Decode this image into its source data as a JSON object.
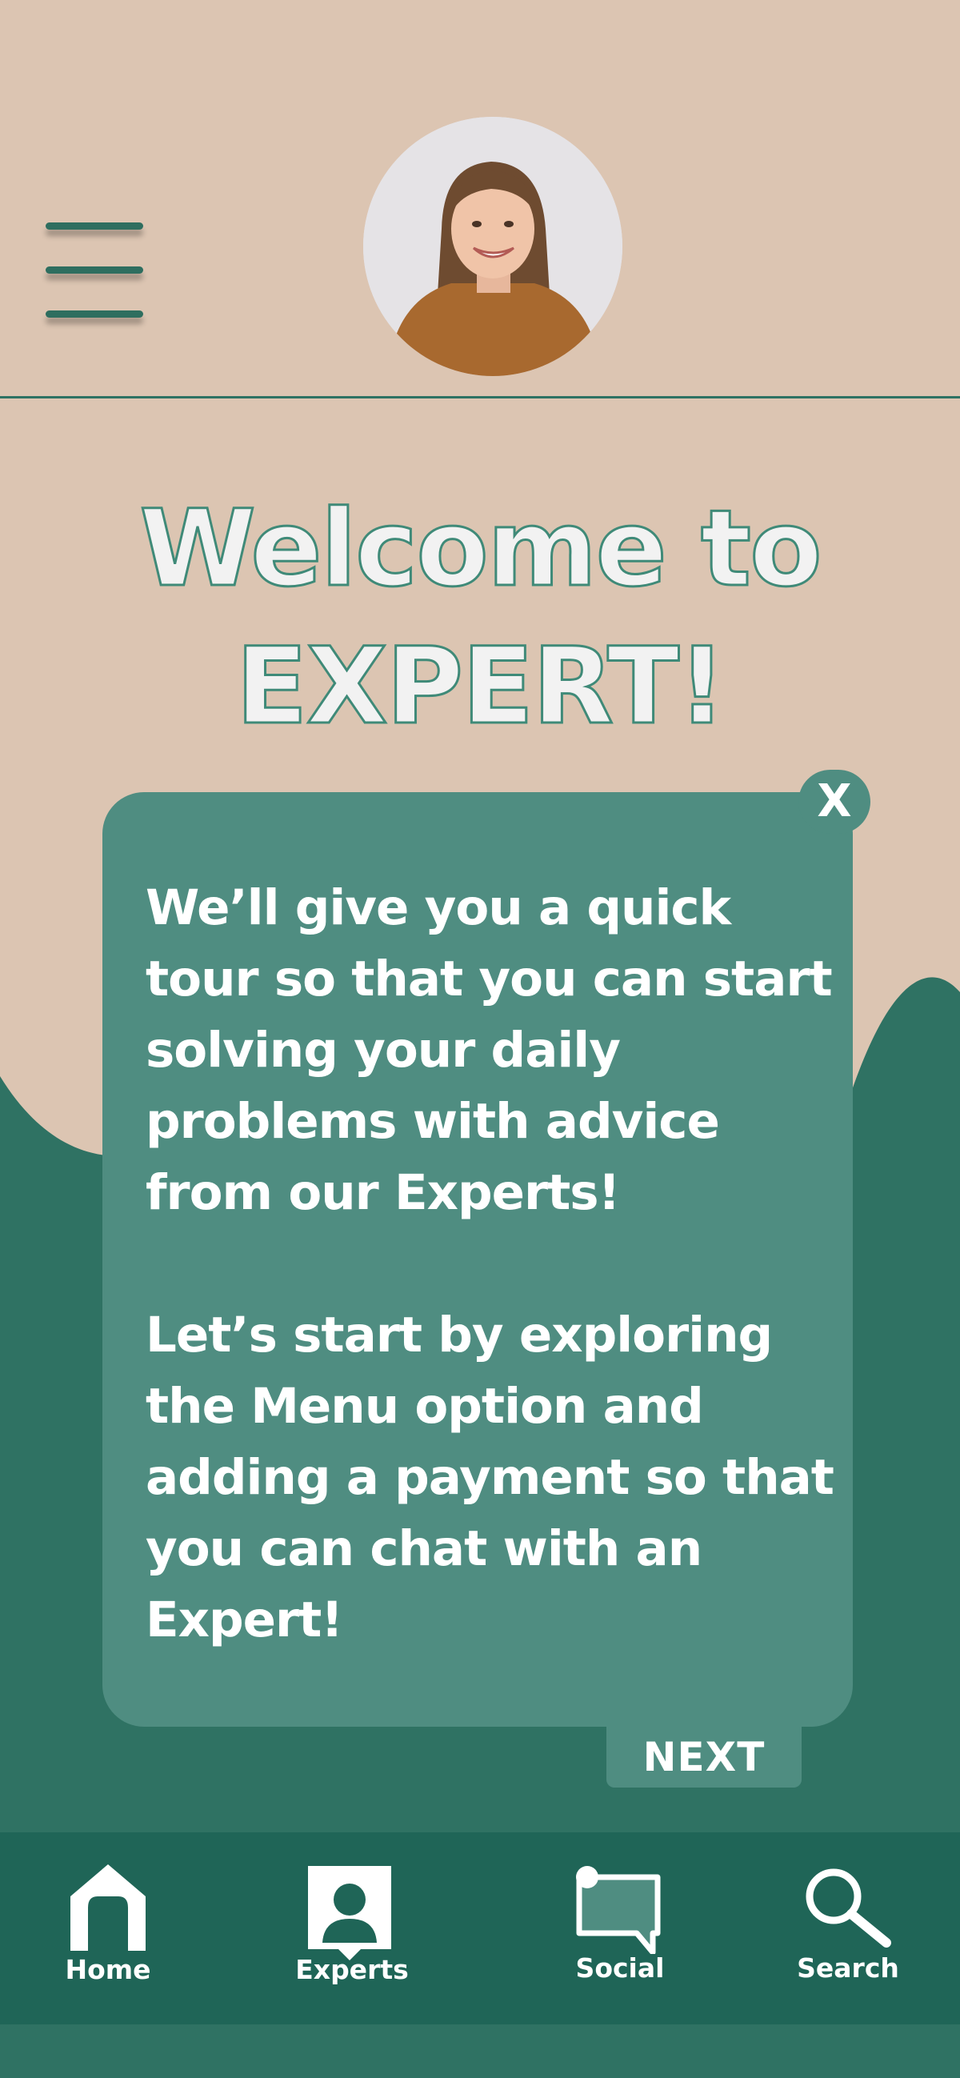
{
  "header": {
    "menu_icon": "hamburger-menu-icon",
    "avatar_icon": "user-avatar-photo"
  },
  "welcome": {
    "line1": "Welcome to",
    "line2": "EXPERT!"
  },
  "tour": {
    "paragraph1": "We’ll give you a quick tour so that you can start solving your daily problems with advice from our Experts!",
    "paragraph2": "Let’s start by exploring the Menu option and adding a payment so that you can chat with an Expert!",
    "close_label": "X",
    "next_label": "NEXT"
  },
  "nav": {
    "items": [
      {
        "label": "Home",
        "icon": "home-icon"
      },
      {
        "label": "Experts",
        "icon": "experts-icon"
      },
      {
        "label": "Social",
        "icon": "chat-bubble-icon"
      },
      {
        "label": "Search",
        "icon": "search-icon"
      }
    ]
  },
  "colors": {
    "background": "#dcc5b2",
    "dark_green": "#2f7263",
    "card_green": "#4f8d81",
    "nav_green": "#1f6557"
  }
}
